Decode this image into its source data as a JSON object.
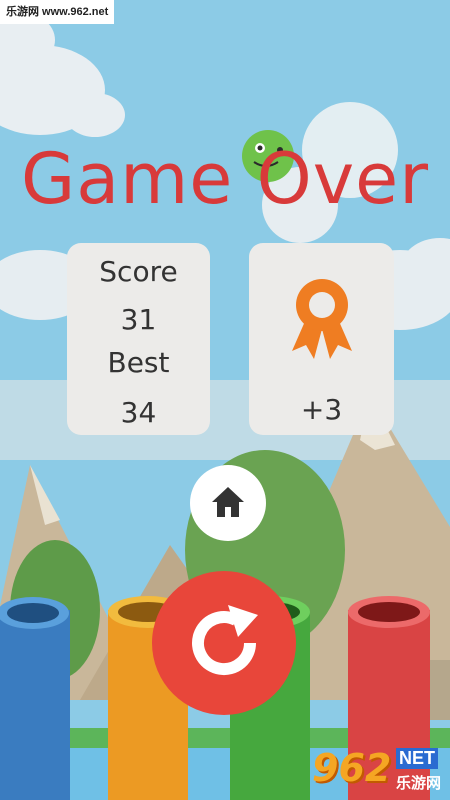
{
  "watermark": "乐游网 www.962.net",
  "title": "Game Over",
  "score_card": {
    "score_label": "Score",
    "score_value": "31",
    "best_label": "Best",
    "best_value": "34"
  },
  "reward_card": {
    "icon": "ribbon-medal-icon",
    "value": "+3"
  },
  "buttons": {
    "home_icon": "home-icon",
    "restart_icon": "restart-icon"
  },
  "logo": {
    "main": "962",
    "net": "NET",
    "cn": "乐游网"
  },
  "colors": {
    "sky": "#8ccbe6",
    "title": "#d83a3a",
    "card": "#ecebe9",
    "medal": "#ef7d22",
    "restart": "#e8463a",
    "pipe_blue": "#3a7cc0",
    "pipe_orange": "#ec9a23",
    "pipe_green": "#46a83e",
    "pipe_red": "#d94444"
  }
}
